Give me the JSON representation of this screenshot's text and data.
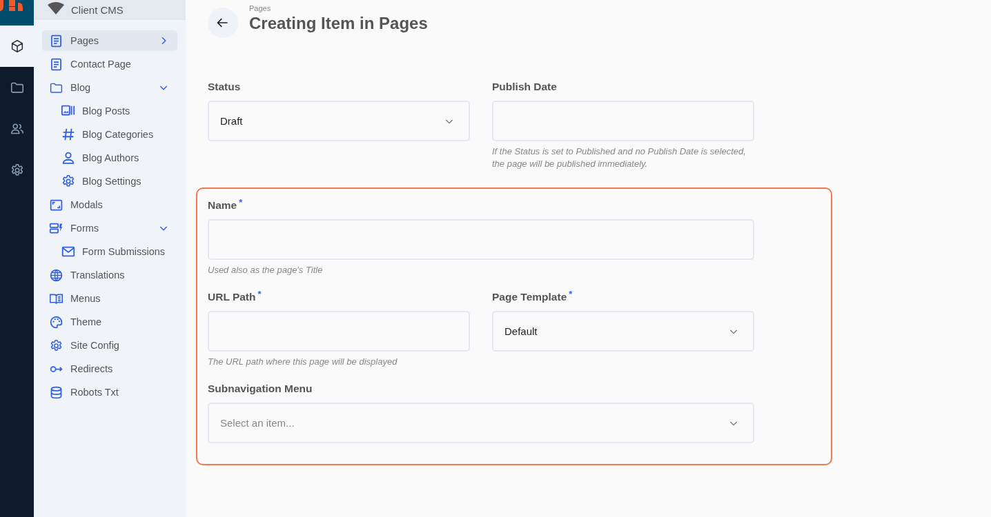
{
  "workspace": {
    "name": "Client CMS"
  },
  "rail": [
    {
      "selected": true
    },
    {
      "selected": false
    },
    {
      "selected": false
    },
    {
      "selected": false
    }
  ],
  "sidebar": {
    "items": [
      {
        "label": "Pages",
        "selected": true,
        "expanded": false
      },
      {
        "label": "Contact Page",
        "selected": false
      },
      {
        "label": "Blog",
        "selected": false,
        "expanded": true,
        "children": [
          {
            "label": "Blog Posts",
            "selected": false
          },
          {
            "label": "Blog Categories",
            "selected": false
          },
          {
            "label": "Blog Authors",
            "selected": false
          },
          {
            "label": "Blog Settings",
            "selected": false
          }
        ]
      },
      {
        "label": "Modals",
        "selected": false
      },
      {
        "label": "Forms",
        "selected": false,
        "expanded": true,
        "children": [
          {
            "label": "Form Submissions",
            "selected": false
          }
        ]
      },
      {
        "label": "Translations",
        "selected": false
      },
      {
        "label": "Menus",
        "selected": false
      },
      {
        "label": "Theme",
        "selected": false
      },
      {
        "label": "Site Config",
        "selected": false
      },
      {
        "label": "Redirects",
        "selected": false
      },
      {
        "label": "Robots Txt",
        "selected": false
      }
    ]
  },
  "header": {
    "breadcrumb": "Pages",
    "title": "Creating Item in Pages"
  },
  "form": {
    "rows": [
      {
        "fields": [
          {
            "kind": "select",
            "label": "Status",
            "value": "Draft"
          },
          {
            "kind": "text",
            "label": "Publish Date",
            "help": "If the Status is set to Published and no Publish Date is selected, the page will be published immediately."
          }
        ]
      },
      {
        "fields": [
          {
            "kind": "text",
            "label": "Name",
            "required_mark": "*",
            "help": "Used also as the page's Title"
          }
        ]
      },
      {
        "fields": [
          {
            "kind": "text",
            "label": "URL Path",
            "required_mark": "*",
            "help": "The URL path where this page will be displayed"
          },
          {
            "kind": "select",
            "label": "Page Template",
            "required_mark": "*",
            "value": "Default"
          }
        ]
      },
      {
        "fields": [
          {
            "kind": "select",
            "label": "Subnavigation Menu",
            "placeholder": "Select an item..."
          }
        ]
      }
    ]
  }
}
